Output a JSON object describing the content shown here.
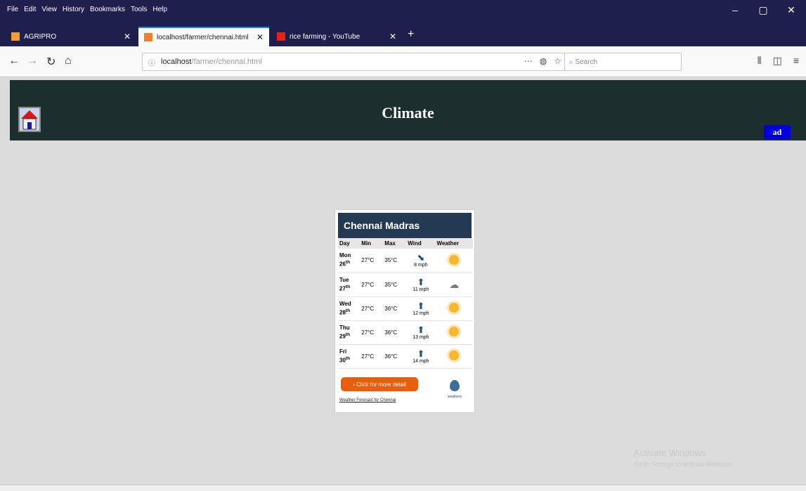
{
  "menu": [
    "File",
    "Edit",
    "View",
    "History",
    "Bookmarks",
    "Tools",
    "Help"
  ],
  "window_controls": [
    "–",
    "▢",
    "✕"
  ],
  "tabs": [
    {
      "label": "AGRIPRO",
      "fav_color": "#f0a030"
    },
    {
      "label": "localhost/farmer/chennai.html",
      "fav_color": "#f08030"
    },
    {
      "label": "rice farming - YouTube",
      "fav_color": "#e62117"
    }
  ],
  "url": {
    "host": "localhost",
    "path": "/farmer/chennai.html"
  },
  "search_placeholder": "Search",
  "page": {
    "title": "Climate",
    "badge": "ad"
  },
  "widget": {
    "city": "Chennai Madras",
    "headers": {
      "day": "Day",
      "min": "Min",
      "max": "Max",
      "wind": "Wind",
      "weather": "Weather"
    },
    "rows": [
      {
        "day": "Mon",
        "date": "26",
        "suffix": "th",
        "min": "27°C",
        "max": "35°C",
        "wind_arrow": "⬊",
        "wind": "8 mph",
        "weather": "sun"
      },
      {
        "day": "Tue",
        "date": "27",
        "suffix": "th",
        "min": "27°C",
        "max": "35°C",
        "wind_arrow": "⬆",
        "wind": "11 mph",
        "weather": "cloud"
      },
      {
        "day": "Wed",
        "date": "28",
        "suffix": "th",
        "min": "27°C",
        "max": "36°C",
        "wind_arrow": "⬆",
        "wind": "12 mph",
        "weather": "sun"
      },
      {
        "day": "Thu",
        "date": "29",
        "suffix": "th",
        "min": "27°C",
        "max": "36°C",
        "wind_arrow": "⬆",
        "wind": "13 mph",
        "weather": "sun"
      },
      {
        "day": "Fri",
        "date": "30",
        "suffix": "th",
        "min": "27°C",
        "max": "36°C",
        "wind_arrow": "⬆",
        "wind": "14 mph",
        "weather": "sun"
      }
    ],
    "button": "› Click for more detail",
    "forecast_link": "Weather Forecast for Chennai",
    "logo_label": "weathers"
  },
  "watermark": {
    "title": "Activate Windows",
    "sub": "Go to Settings to activate Windows."
  }
}
